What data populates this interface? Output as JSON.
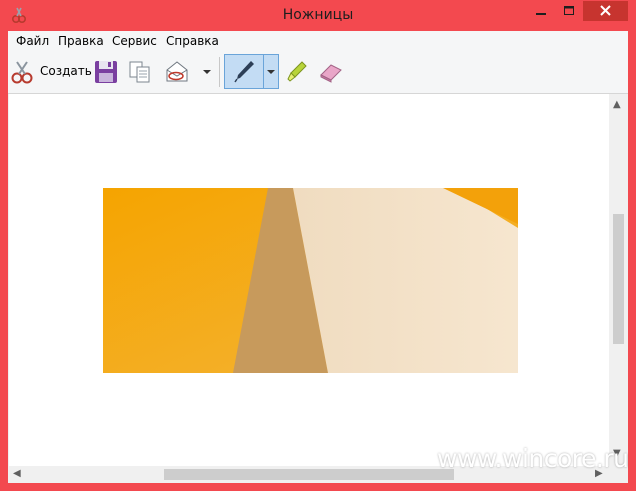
{
  "window": {
    "title": "Ножницы",
    "accent": "#f3494f"
  },
  "menu": [
    "Файл",
    "Правка",
    "Сервис",
    "Справка"
  ],
  "toolbar": {
    "new_label": "Создать",
    "buttons": [
      "scissors-icon",
      "save-icon",
      "copy-icon",
      "send-icon",
      "dropdown-icon",
      "pen-icon",
      "highlighter-icon",
      "eraser-icon"
    ]
  },
  "watermark": "www.wincore.ru"
}
